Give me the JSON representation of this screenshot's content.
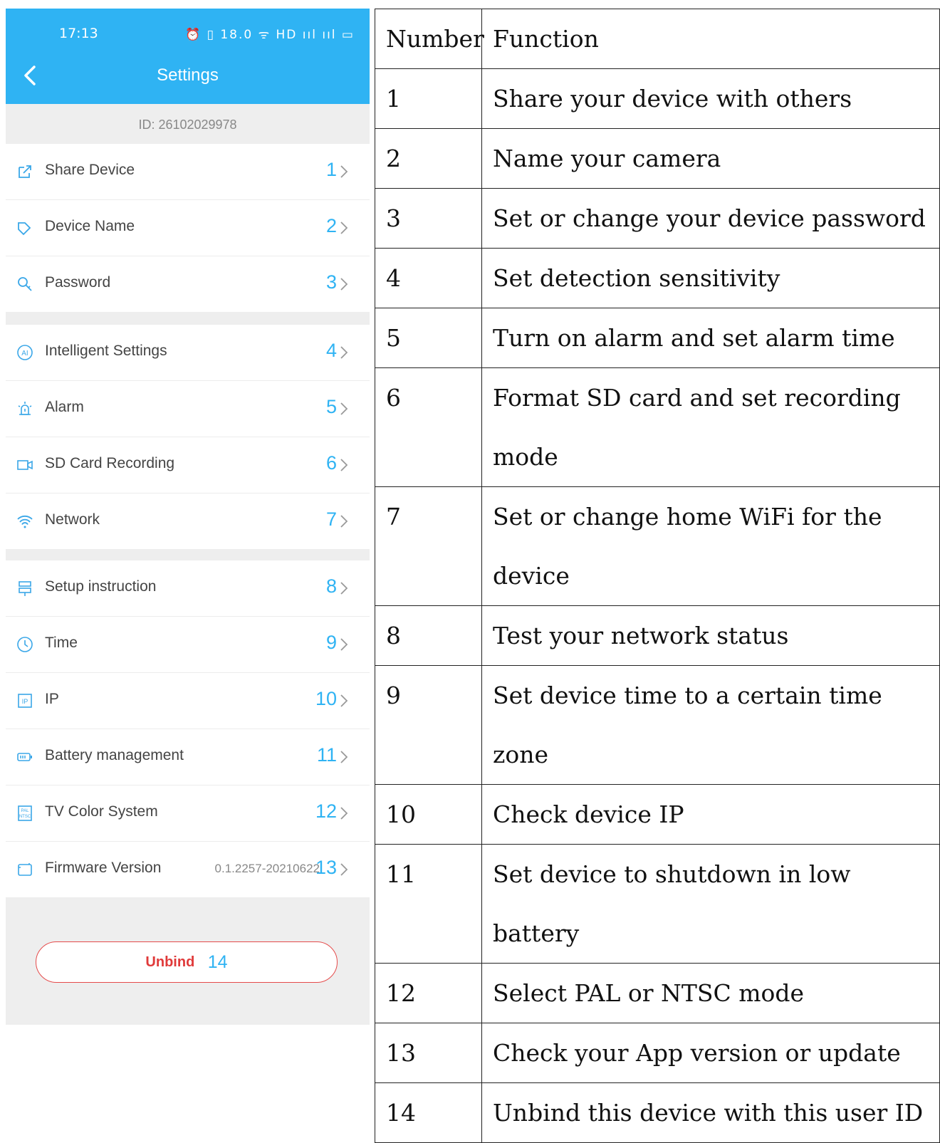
{
  "phone": {
    "status_time": "17:13",
    "status_icons": "⏰ ▯ 18.0 ᯤ HD ııl ııl ▭",
    "title": "Settings",
    "device_id": "ID: 26102029978",
    "accent_color": "#2fb3f3",
    "groups": [
      [
        {
          "icon": "share-icon",
          "label": "Share Device",
          "num": "1"
        },
        {
          "icon": "tag-icon",
          "label": "Device Name",
          "num": "2"
        },
        {
          "icon": "key-icon",
          "label": "Password",
          "num": "3"
        }
      ],
      [
        {
          "icon": "ai-icon",
          "label": "Intelligent Settings",
          "num": "4"
        },
        {
          "icon": "alarm-icon",
          "label": "Alarm",
          "num": "5"
        },
        {
          "icon": "video-camera-icon",
          "label": "SD Card Recording",
          "num": "6"
        },
        {
          "icon": "wifi-icon",
          "label": "Network",
          "num": "7"
        }
      ],
      [
        {
          "icon": "signpost-icon",
          "label": "Setup instruction",
          "num": "8"
        },
        {
          "icon": "clock-icon",
          "label": "Time",
          "num": "9"
        },
        {
          "icon": "ip-icon",
          "label": "IP",
          "num": "10"
        },
        {
          "icon": "battery-icon",
          "label": "Battery management",
          "num": "11"
        },
        {
          "icon": "tv-system-icon",
          "label": "TV Color System",
          "num": "12"
        },
        {
          "icon": "firmware-icon",
          "label": "Firmware Version",
          "num": "13",
          "version": "0.1.2257-20210622"
        }
      ]
    ],
    "unbind_label": "Unbind",
    "unbind_num": "14"
  },
  "table": {
    "headers": [
      "Number",
      "Function"
    ],
    "rows": [
      {
        "num": "1",
        "func": "Share your device with others"
      },
      {
        "num": "2",
        "func": "Name your camera"
      },
      {
        "num": "3",
        "func": "Set or change your device password"
      },
      {
        "num": "4",
        "func": "Set detection sensitivity"
      },
      {
        "num": "5",
        "func": "Turn on alarm and set alarm time"
      },
      {
        "num": "6",
        "func": "Format SD card and set recording mode"
      },
      {
        "num": "7",
        "func": "Set or change home WiFi for the device"
      },
      {
        "num": "8",
        "func": "Test your network status"
      },
      {
        "num": "9",
        "func": "Set device time to a certain time zone"
      },
      {
        "num": "10",
        "func": "Check device IP"
      },
      {
        "num": "11",
        "func": "Set device to shutdown in low battery"
      },
      {
        "num": "12",
        "func": "Select PAL or NTSC mode"
      },
      {
        "num": "13",
        "func": "Check your App version or update"
      },
      {
        "num": "14",
        "func": "Unbind this device with this user ID"
      }
    ]
  }
}
